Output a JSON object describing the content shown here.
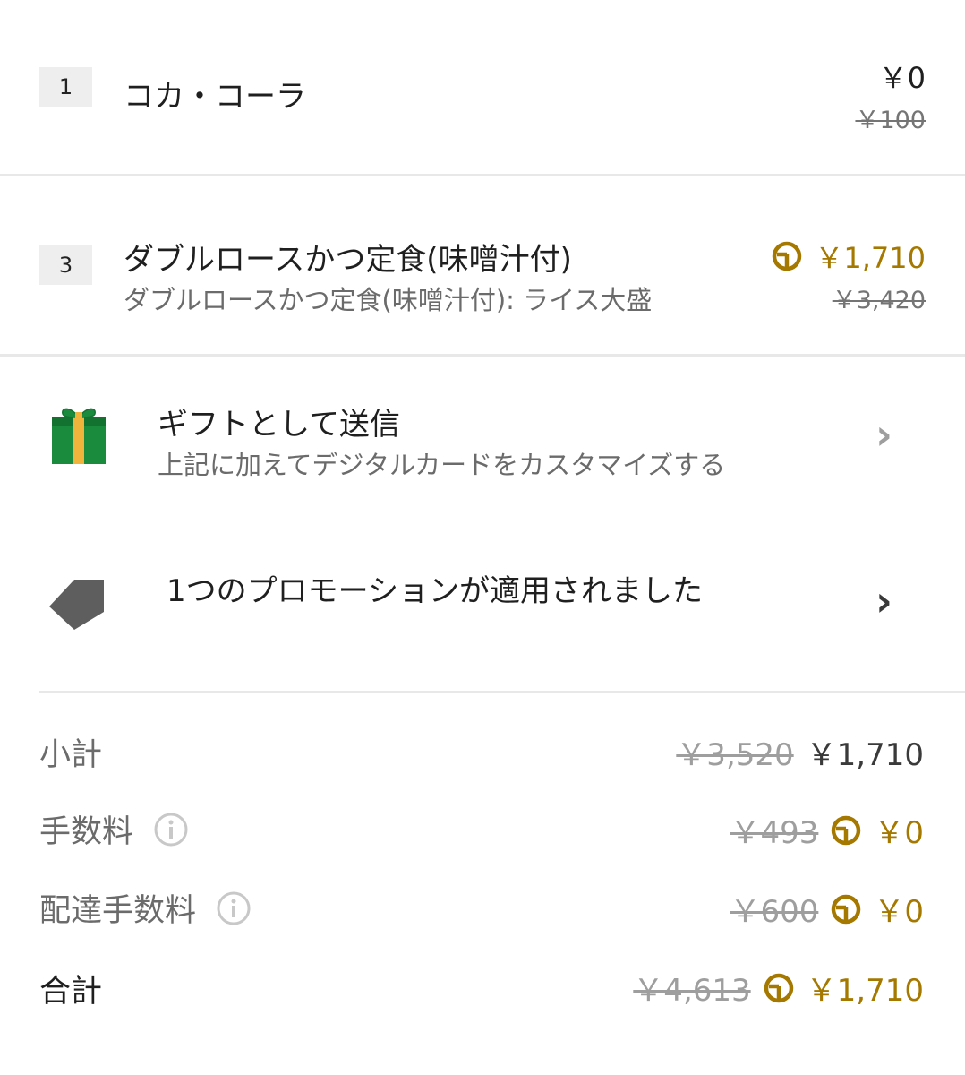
{
  "items": [
    {
      "qty": "1",
      "name": "コカ・コーラ",
      "option": "",
      "price": "￥0",
      "original_price": "￥100"
    },
    {
      "qty": "3",
      "name": "ダブルロースかつ定食(味噌汁付)",
      "option": "ダブルロースかつ定食(味噌汁付): ライス大盛",
      "price": "￥1,710",
      "original_price": "￥3,420"
    }
  ],
  "gift": {
    "title": "ギフトとして送信",
    "subtitle": "上記に加えてデジタルカードをカスタマイズする",
    "icon": "gift-box-icon"
  },
  "promotion": {
    "title": "1つのプロモーションが適用されました",
    "icon": "price-tag-icon"
  },
  "summary": {
    "subtotal": {
      "label": "小計",
      "original": "￥3,520",
      "value": "￥1,710"
    },
    "fee": {
      "label": "手数料",
      "original": "￥493",
      "value": "￥0"
    },
    "delivery_fee": {
      "label": "配達手数料",
      "original": "￥600",
      "value": "￥0"
    },
    "total": {
      "label": "合計",
      "original": "￥4,613",
      "value": "￥1,710"
    }
  },
  "colors": {
    "membership_gold": "#a57800",
    "divider": "#e8e8e8",
    "qty_background": "#eeeeee",
    "gift_green": "#1a8a3c",
    "gift_ribbon": "#f0b43c",
    "tag_gray": "#5e5e5e"
  }
}
